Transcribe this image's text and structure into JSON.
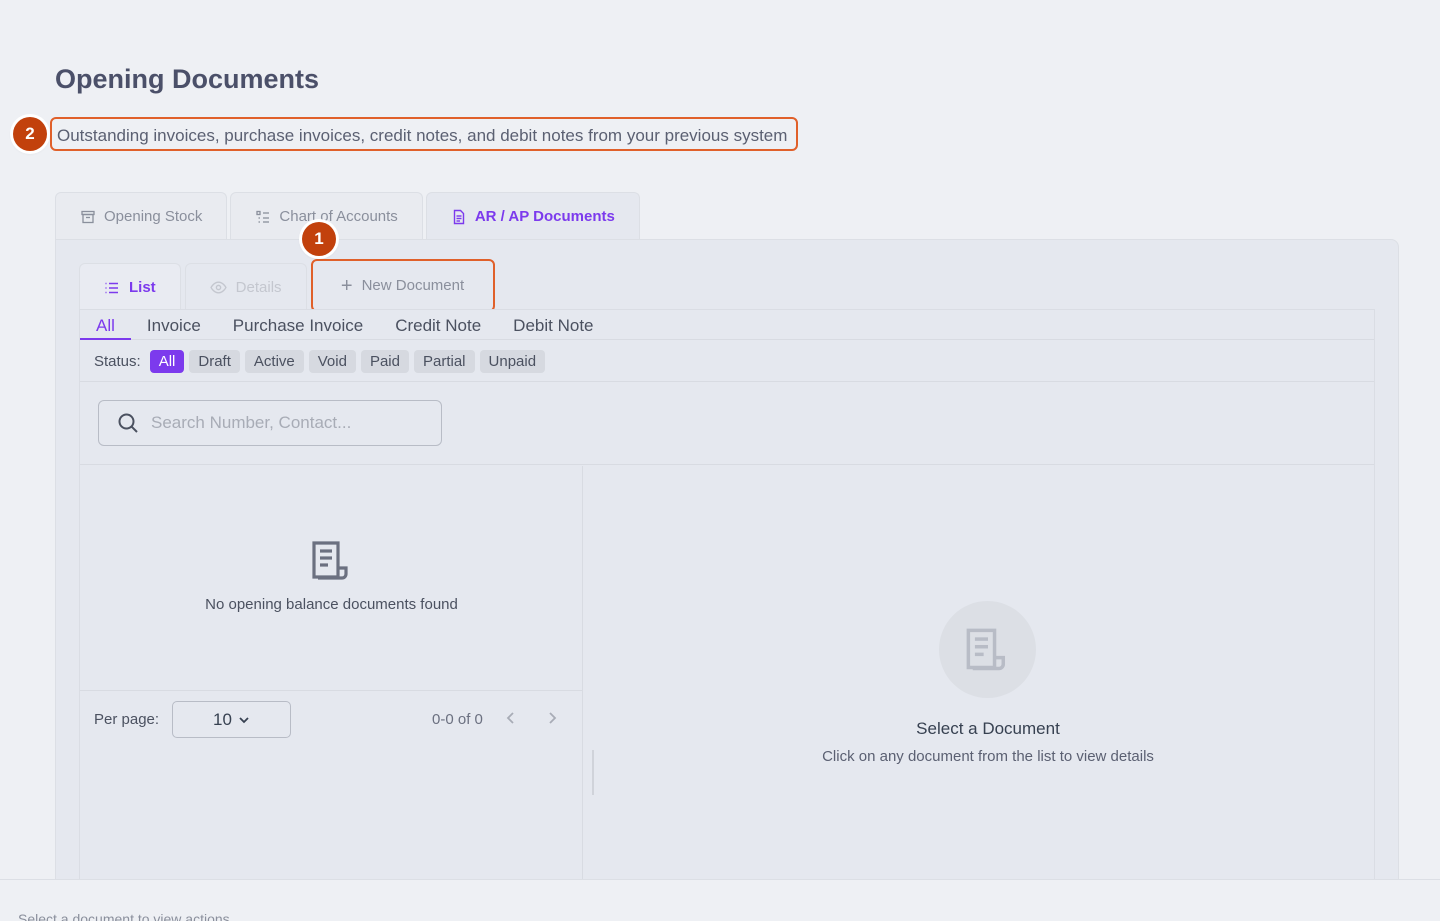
{
  "page": {
    "title": "Opening Documents",
    "subtitle": "Outstanding invoices, purchase invoices, credit notes, and debit notes from your previous system"
  },
  "annotations": [
    "1",
    "2"
  ],
  "top_tabs": [
    {
      "label": "Opening Stock",
      "icon": "inventory-icon"
    },
    {
      "label": "Chart of Accounts",
      "icon": "list-tree-icon"
    },
    {
      "label": "AR / AP Documents",
      "icon": "document-icon",
      "active": true
    }
  ],
  "sub_tabs": {
    "list": "List",
    "details": "Details",
    "new_document": "New Document"
  },
  "type_tabs": [
    "All",
    "Invoice",
    "Purchase Invoice",
    "Credit Note",
    "Debit Note"
  ],
  "status": {
    "label": "Status:",
    "options": [
      "All",
      "Draft",
      "Active",
      "Void",
      "Paid",
      "Partial",
      "Unpaid"
    ],
    "selected": "All"
  },
  "search": {
    "placeholder": "Search Number, Contact...",
    "value": ""
  },
  "list": {
    "empty_text": "No opening balance documents found",
    "per_page_label": "Per page:",
    "per_page_value": "10",
    "range_text": "0-0 of 0"
  },
  "detail": {
    "title": "Select a Document",
    "description": "Click on any document from the list to view details"
  },
  "footer": {
    "text": "Select a document to view actions"
  },
  "colors": {
    "accent": "#7c3aed",
    "highlight": "#e0602a",
    "badge": "#c2410c"
  }
}
